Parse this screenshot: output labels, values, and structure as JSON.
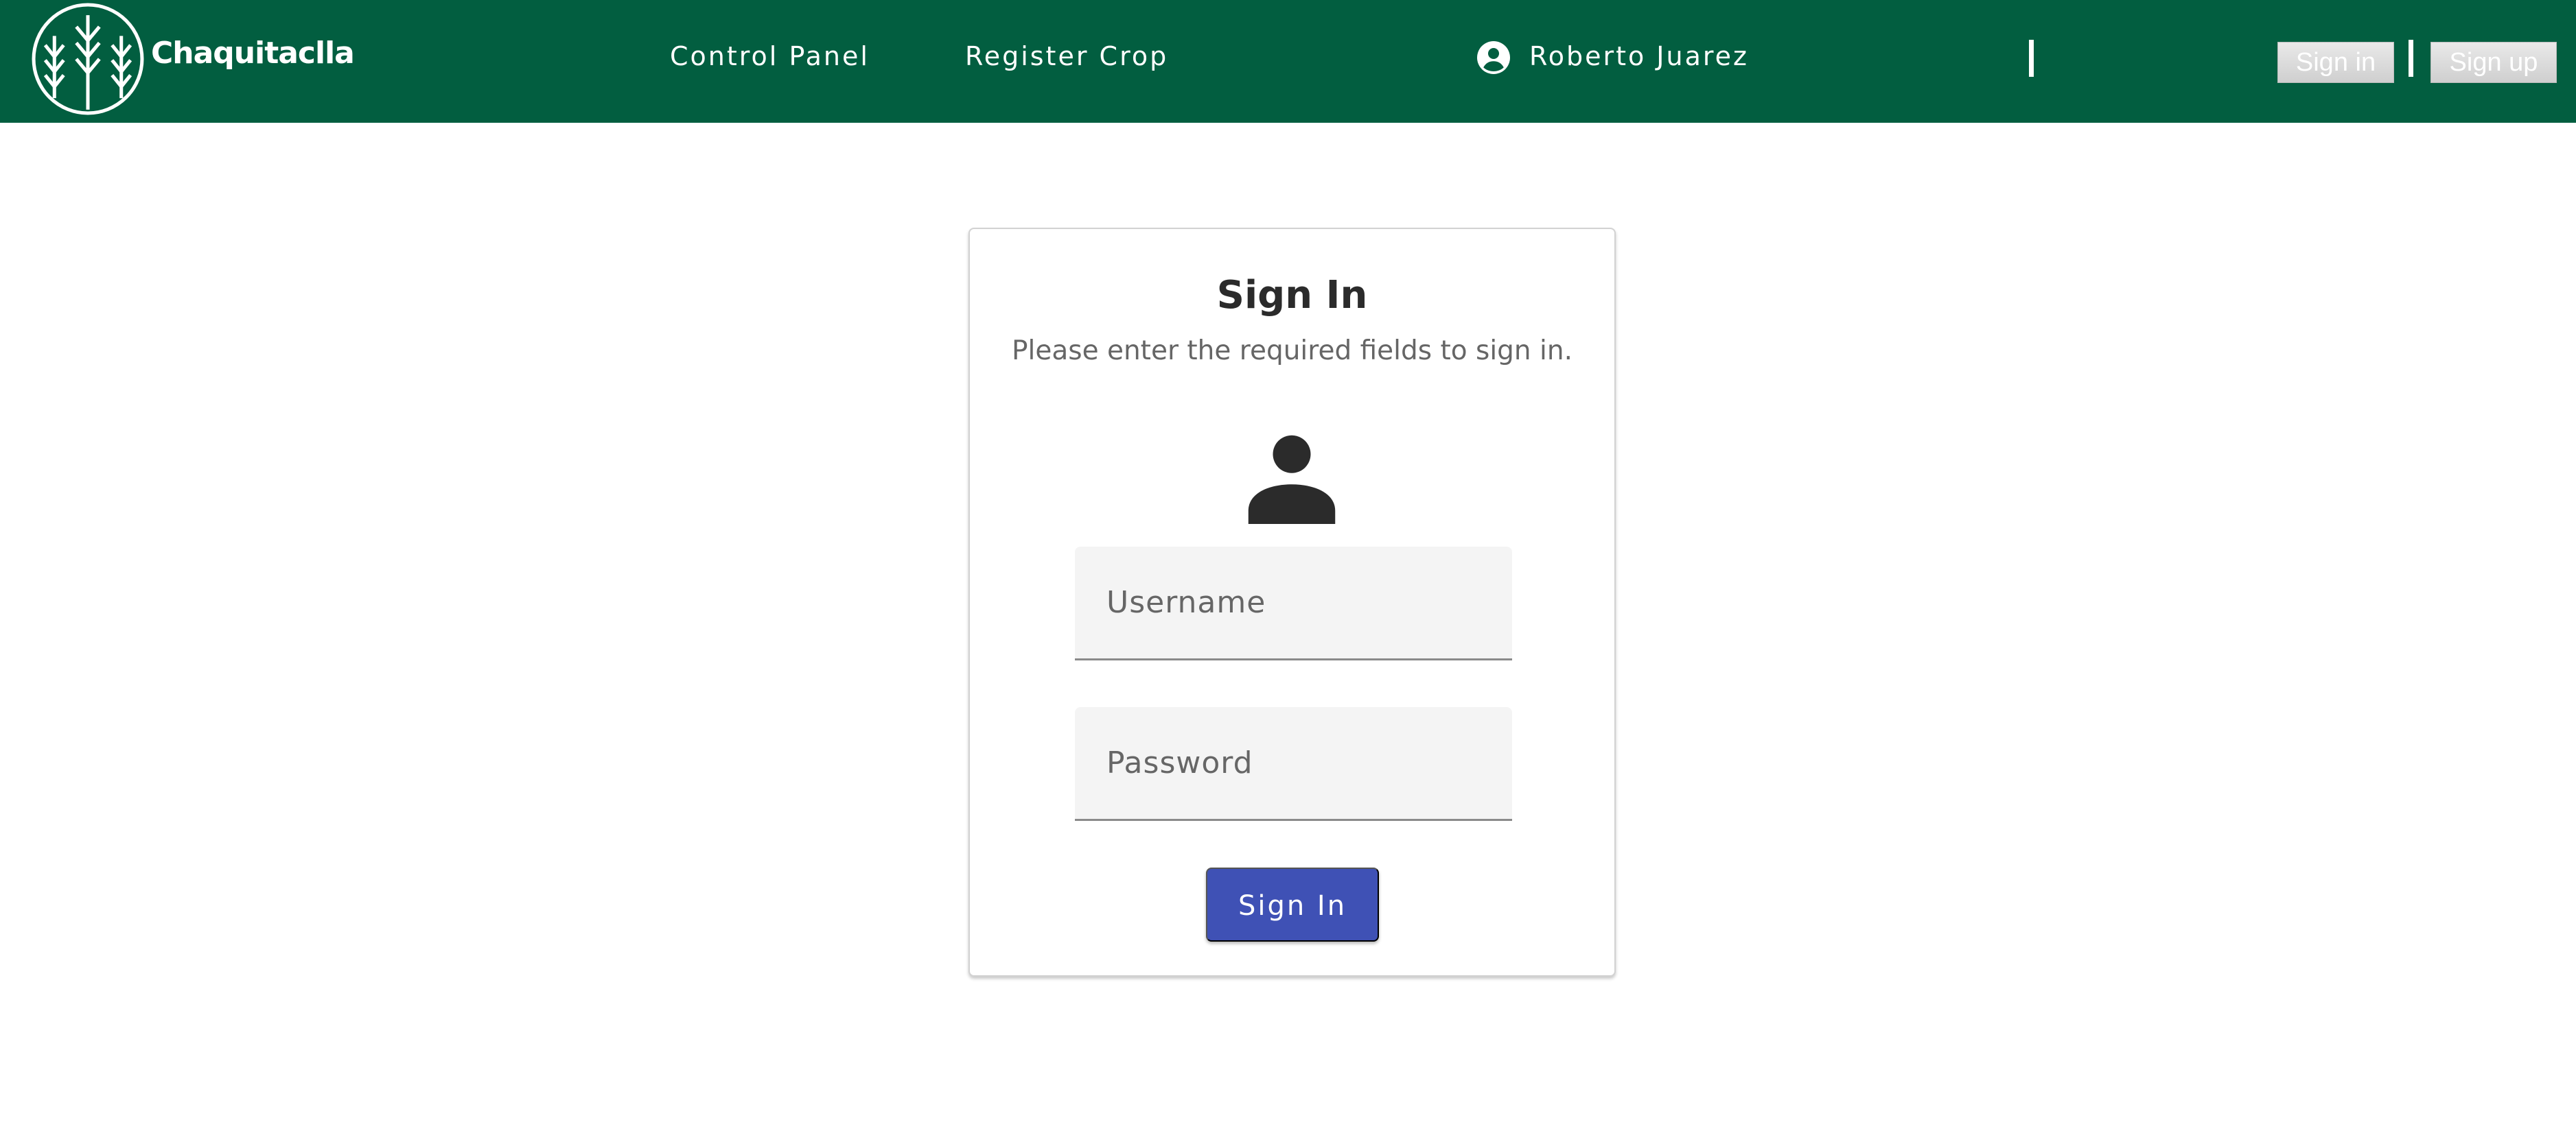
{
  "header": {
    "brand": "Chaquitaclla",
    "logo_icon": "wheat-logo-icon",
    "nav": {
      "control_panel": "Control Panel",
      "register_crop": "Register Crop"
    },
    "user": {
      "icon": "account-circle-icon",
      "name": "Roberto Juarez"
    },
    "auth": {
      "sign_in": "Sign in",
      "sign_up": "Sign up"
    }
  },
  "signin_card": {
    "title": "Sign In",
    "subtitle": "Please enter the required fields to sign in.",
    "avatar_icon": "person-icon",
    "username": {
      "placeholder": "Username",
      "value": ""
    },
    "password": {
      "placeholder": "Password",
      "value": ""
    },
    "submit_label": "Sign In"
  },
  "colors": {
    "header_bg": "#025e40",
    "primary_button": "#3f51b5",
    "page_bg": "#ffffff",
    "field_bg": "#f4f4f4"
  }
}
